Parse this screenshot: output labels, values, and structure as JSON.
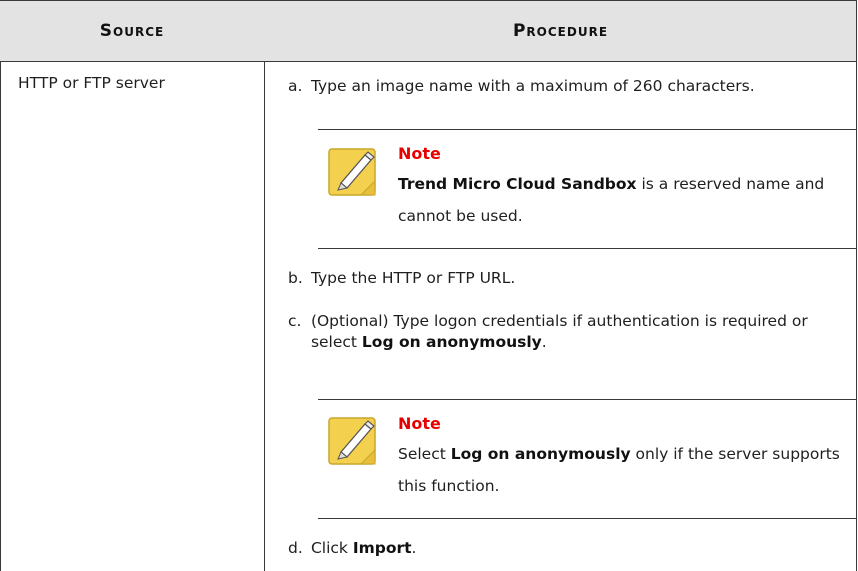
{
  "table": {
    "headers": {
      "source": "Source",
      "procedure": "Procedure"
    },
    "source": "HTTP or FTP server",
    "steps": {
      "a": {
        "letter": "a.",
        "text": "Type an image name with a maximum of 260 characters."
      },
      "b": {
        "letter": "b.",
        "text": "Type the HTTP or FTP URL."
      },
      "c": {
        "letter": "c.",
        "text_before": "(Optional) Type logon credentials if authentication is required or select ",
        "bold": "Log on anonymously",
        "text_after": "."
      },
      "d": {
        "letter": "d.",
        "text_before": "Click ",
        "bold": "Import",
        "text_after": "."
      }
    },
    "notes": [
      {
        "title": "Note",
        "bold": "Trend Micro Cloud Sandbox",
        "text": " is a reserved name and cannot be used."
      },
      {
        "title": "Note",
        "text_before": "Select ",
        "bold": "Log on anonymously",
        "text_after": " only if the server supports this function."
      }
    ]
  },
  "icon": {
    "name": "note-pencil-icon",
    "pad_color": "#f3d04e",
    "pad_border": "#c9a52d"
  },
  "colors": {
    "note_title": "#e60000",
    "header_bg": "#e3e3e3"
  }
}
